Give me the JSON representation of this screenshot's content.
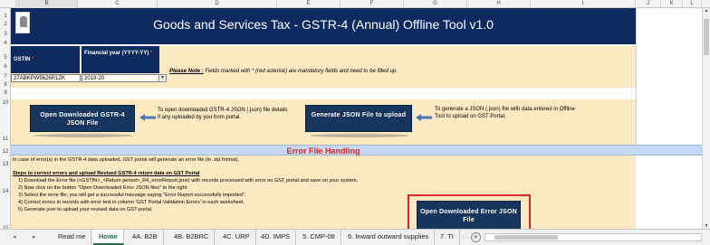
{
  "columns": [
    "B",
    "C",
    "D",
    "E",
    "F",
    "G",
    "H",
    "I",
    "J",
    "K",
    "L"
  ],
  "rows": [
    "1",
    "2",
    "3",
    "4",
    "5",
    "6",
    "7",
    "8",
    "9",
    "10",
    "11",
    "12",
    "13",
    "14",
    "15"
  ],
  "header": {
    "title": "Goods and Services Tax - GSTR-4 (Annual) Offline Tool  v1.0"
  },
  "fields": {
    "gstin_label": "GSTIN",
    "gstin_value": "27ABKPW5626R1ZK",
    "fy_label": "Financial year (YYYY-YY)",
    "fy_value": "2019-20"
  },
  "note": {
    "label": "Please Note :",
    "text": " Fields marked with * (red asterisk) are mandatory fields and need to be filled up."
  },
  "actions": {
    "open_json_label": "Open Downloaded GSTR-4 JSON File",
    "open_json_desc": "To open downloaded GSTR-4 JSON (.json) file details if any uploaded by you from portal.",
    "generate_json_label": "Generate JSON File to upload",
    "generate_json_desc": "To generate a JSON (.json) file with data entered in Offline Tool to upload on GST Portal."
  },
  "error_section": {
    "title": "Error File Handling",
    "intro": "In case of error(s) in the GSTR-4 data uploaded, GST portal will generate an error file (in .zip format).",
    "steps_title": "Steps to correct errors and upload Revised GSTR-4 return data on GST Portal",
    "steps": [
      "1) Download the Error file  (<GSTIN>_<Return period>_R4_errorReport.json) with records processed with error on GST portal and save on your system.",
      "2) Now click on the button \"Open Downloaded Error JSON files\" to the right.",
      "3) Select the error file; you will get a successful message saying \"Error Report successfully imported\".",
      "4) Correct errors in records with error text in column 'GST Portal Validation Errors' in each worksheet.",
      "5) Generate json to upload your revised data on GST-portal."
    ],
    "open_error_label": "Open Downloaded Error JSON File"
  },
  "tabs": [
    {
      "label": "Read me",
      "active": false
    },
    {
      "label": "Home",
      "active": true
    },
    {
      "label": "4A. B2B",
      "active": false
    },
    {
      "label": "4B. B2BRC",
      "active": false
    },
    {
      "label": "4C. URP",
      "active": false
    },
    {
      "label": "4D. IMPS",
      "active": false
    },
    {
      "label": "5. CMP-08",
      "active": false
    },
    {
      "label": "6. Inward outward supplies",
      "active": false
    },
    {
      "label": "7. TI",
      "active": false
    }
  ],
  "colors": {
    "navy": "#0e2a5e",
    "cream": "#fbe9c2",
    "error_red": "#d9262c",
    "light_blue": "#c5d9f1",
    "excel_green": "#1e7145"
  }
}
